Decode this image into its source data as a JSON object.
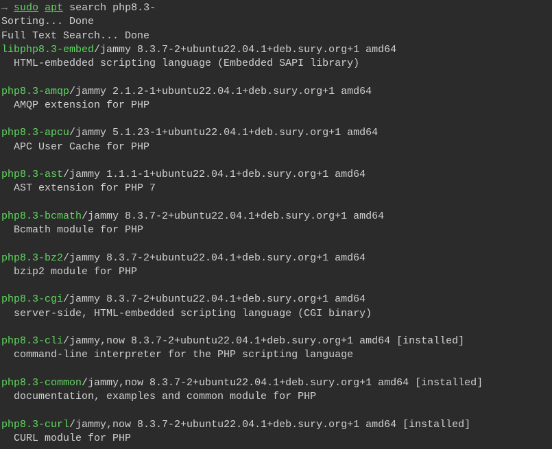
{
  "prompt": {
    "arrow": "→",
    "sudo": "sudo",
    "apt": "apt",
    "args": "search php8.3-"
  },
  "status": {
    "sorting": "Sorting... Done",
    "fulltext": "Full Text Search... Done"
  },
  "packages": [
    {
      "name": "libphp8.3-embed",
      "meta": "/jammy 8.3.7-2+ubuntu22.04.1+deb.sury.org+1 amd64",
      "desc": "HTML-embedded scripting language (Embedded SAPI library)"
    },
    {
      "name": "php8.3-amqp",
      "meta": "/jammy 2.1.2-1+ubuntu22.04.1+deb.sury.org+1 amd64",
      "desc": "AMQP extension for PHP"
    },
    {
      "name": "php8.3-apcu",
      "meta": "/jammy 5.1.23-1+ubuntu22.04.1+deb.sury.org+1 amd64",
      "desc": "APC User Cache for PHP"
    },
    {
      "name": "php8.3-ast",
      "meta": "/jammy 1.1.1-1+ubuntu22.04.1+deb.sury.org+1 amd64",
      "desc": "AST extension for PHP 7"
    },
    {
      "name": "php8.3-bcmath",
      "meta": "/jammy 8.3.7-2+ubuntu22.04.1+deb.sury.org+1 amd64",
      "desc": "Bcmath module for PHP"
    },
    {
      "name": "php8.3-bz2",
      "meta": "/jammy 8.3.7-2+ubuntu22.04.1+deb.sury.org+1 amd64",
      "desc": "bzip2 module for PHP"
    },
    {
      "name": "php8.3-cgi",
      "meta": "/jammy 8.3.7-2+ubuntu22.04.1+deb.sury.org+1 amd64",
      "desc": "server-side, HTML-embedded scripting language (CGI binary)"
    },
    {
      "name": "php8.3-cli",
      "meta": "/jammy,now 8.3.7-2+ubuntu22.04.1+deb.sury.org+1 amd64 [installed]",
      "desc": "command-line interpreter for the PHP scripting language"
    },
    {
      "name": "php8.3-common",
      "meta": "/jammy,now 8.3.7-2+ubuntu22.04.1+deb.sury.org+1 amd64 [installed]",
      "desc": "documentation, examples and common module for PHP"
    },
    {
      "name": "php8.3-curl",
      "meta": "/jammy,now 8.3.7-2+ubuntu22.04.1+deb.sury.org+1 amd64 [installed]",
      "desc": "CURL module for PHP"
    }
  ]
}
